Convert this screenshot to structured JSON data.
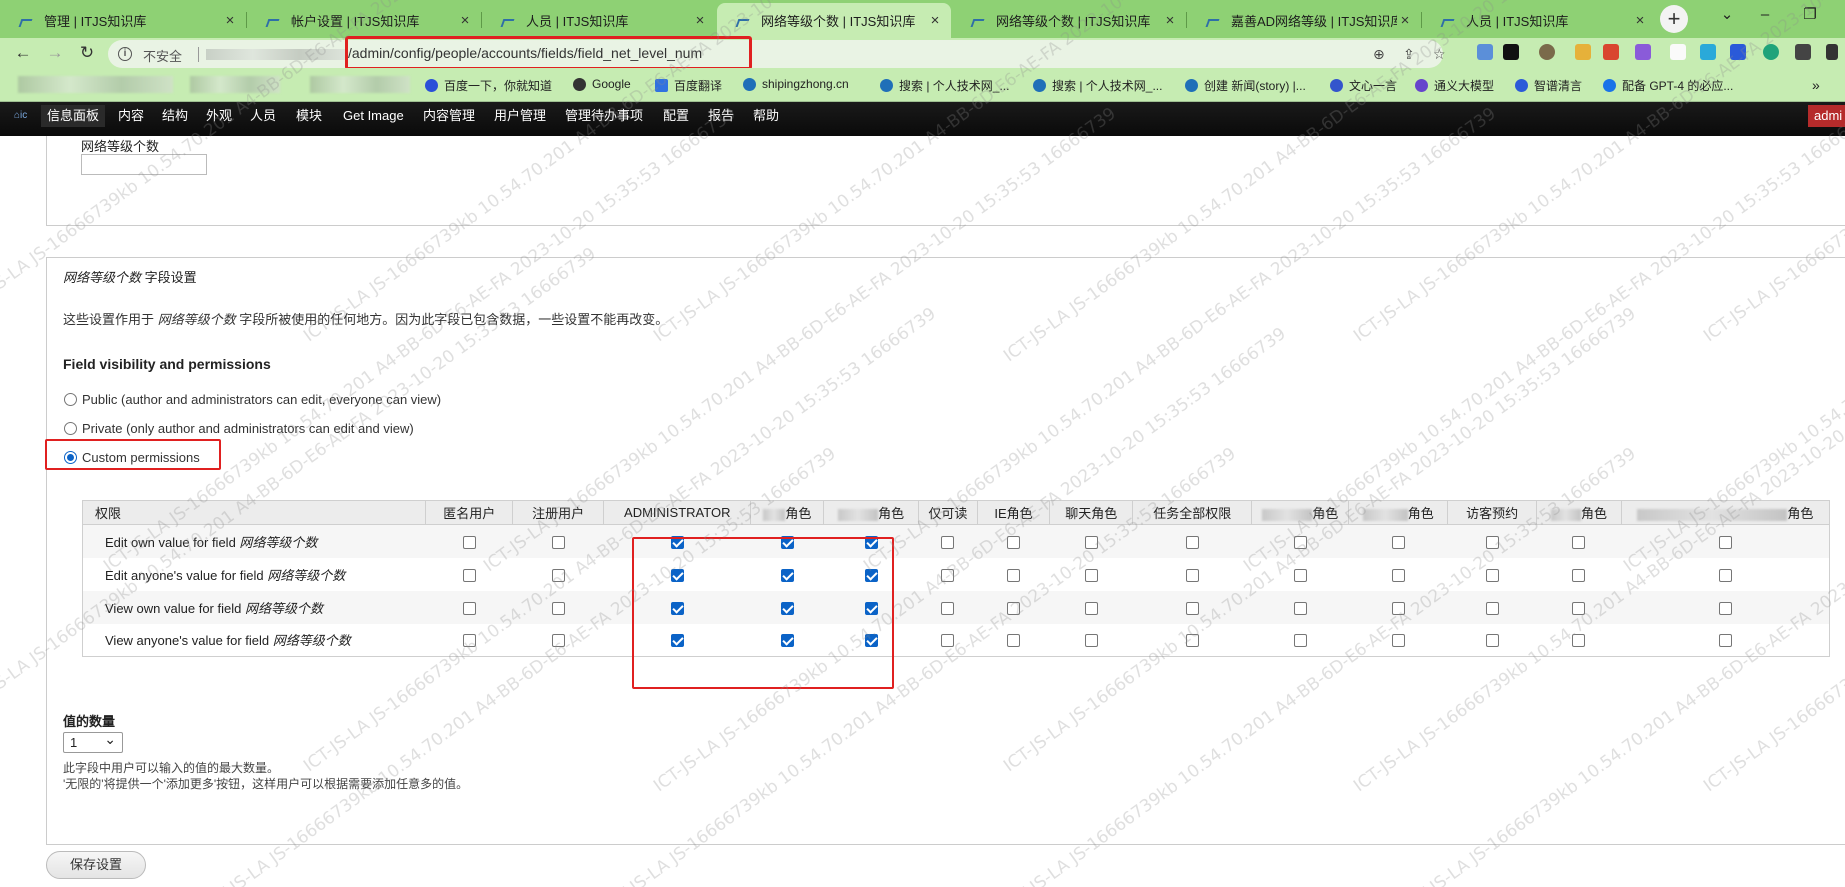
{
  "tabs": [
    {
      "title": "管理 | ITJS知识库",
      "active": false
    },
    {
      "title": "帐户设置 | ITJS知识库",
      "active": false
    },
    {
      "title": "人员 | ITJS知识库",
      "active": false
    },
    {
      "title": "网络等级个数 | ITJS知识库",
      "active": true
    },
    {
      "title": "网络等级个数 | ITJS知识库",
      "active": false
    },
    {
      "title": "嘉善AD网络等级 | ITJS知识库",
      "active": false
    },
    {
      "title": "人员 | ITJS知识库",
      "active": false
    }
  ],
  "toolbar": {
    "insecure_label": "不安全",
    "url_path": "/admin/config/people/accounts/fields/field_net_level_num"
  },
  "bookmarks": [
    {
      "label": "百度一下，你就知道",
      "icon_color": "#2a50d8"
    },
    {
      "label": "Google",
      "icon_color": "#333333"
    },
    {
      "label": "百度翻译",
      "icon_color": "#3172e0"
    },
    {
      "label": "shipingzhong.cn",
      "icon_color": "#1f6fb8"
    },
    {
      "label": "搜索 | 个人技术网_...",
      "icon_color": "#1f6fb8"
    },
    {
      "label": "搜索 | 个人技术网_...",
      "icon_color": "#1f6fb8"
    },
    {
      "label": "创建 新闻(story) |...",
      "icon_color": "#1f6fb8"
    },
    {
      "label": "文心一言",
      "icon_color": "#3355cc"
    },
    {
      "label": "通义大模型",
      "icon_color": "#6644cc"
    },
    {
      "label": "智谱清言",
      "icon_color": "#2b5ad8"
    },
    {
      "label": "配备 GPT-4 的必应...",
      "icon_color": "#1a73e8"
    }
  ],
  "admin_menu": [
    "信息面板",
    "内容",
    "结构",
    "外观",
    "人员",
    "模块",
    "Get Image",
    "内容管理",
    "用户管理",
    "管理待办事项",
    "配置",
    "报告",
    "帮助"
  ],
  "admin_user": "admi",
  "prev_field": {
    "label": "网络等级个数"
  },
  "field_settings": {
    "legend_em": "网络等级个数",
    "legend_rest": " 字段设置",
    "desc_prefix": "这些设置作用于 ",
    "desc_em": "网络等级个数",
    "desc_suffix": " 字段所被使用的任何地方。因为此字段已包含数据，一些设置不能再改变。"
  },
  "visibility": {
    "title": "Field visibility and permissions",
    "options": [
      {
        "label": "Public (author and administrators can edit, everyone can view)",
        "checked": false
      },
      {
        "label": "Private (only author and administrators can edit and view)",
        "checked": false
      },
      {
        "label": "Custom permissions",
        "checked": true
      }
    ]
  },
  "permissions": {
    "headers": [
      "权限",
      "匿名用户",
      "注册用户",
      "ADMINISTRATOR",
      "角色",
      "角色",
      "仅可读",
      "IE角色",
      "聊天角色",
      "任务全部权限",
      "角色",
      "角色",
      "访客预约",
      "角色",
      "角色"
    ],
    "rows": [
      {
        "prefix": "Edit own value for field ",
        "field": "网络等级个数",
        "checks": [
          false,
          false,
          true,
          true,
          true,
          false,
          false,
          false,
          false,
          false,
          false,
          false,
          false,
          false
        ]
      },
      {
        "prefix": "Edit anyone's value for field ",
        "field": "网络等级个数",
        "checks": [
          false,
          false,
          true,
          true,
          true,
          false,
          false,
          false,
          false,
          false,
          false,
          false,
          false,
          false
        ]
      },
      {
        "prefix": "View own value for field ",
        "field": "网络等级个数",
        "checks": [
          false,
          false,
          true,
          true,
          true,
          false,
          false,
          false,
          false,
          false,
          false,
          false,
          false,
          false
        ]
      },
      {
        "prefix": "View anyone's value for field ",
        "field": "网络等级个数",
        "checks": [
          false,
          false,
          true,
          true,
          true,
          false,
          false,
          false,
          false,
          false,
          false,
          false,
          false,
          false
        ]
      }
    ]
  },
  "cardinality": {
    "label": "值的数量",
    "selected": "1",
    "help1": "此字段中用户可以输入的值的最大数量。",
    "help2": "'无限的'将提供一个'添加更多'按钮，这样用户可以根据需要添加任意多的值。"
  },
  "save_label": "保存设置",
  "watermark": "ICT-JS-LA  JS-16666739kb  10.54.70.201  A4-BB-6D-E6-AE-FA  2023-10-20  15:35:53  16666739",
  "colors": {
    "tab_strip": "#8ed174",
    "toolbar": "#c6ecb2",
    "highlight": "#e02020",
    "checkbox": "#0b63c7"
  }
}
